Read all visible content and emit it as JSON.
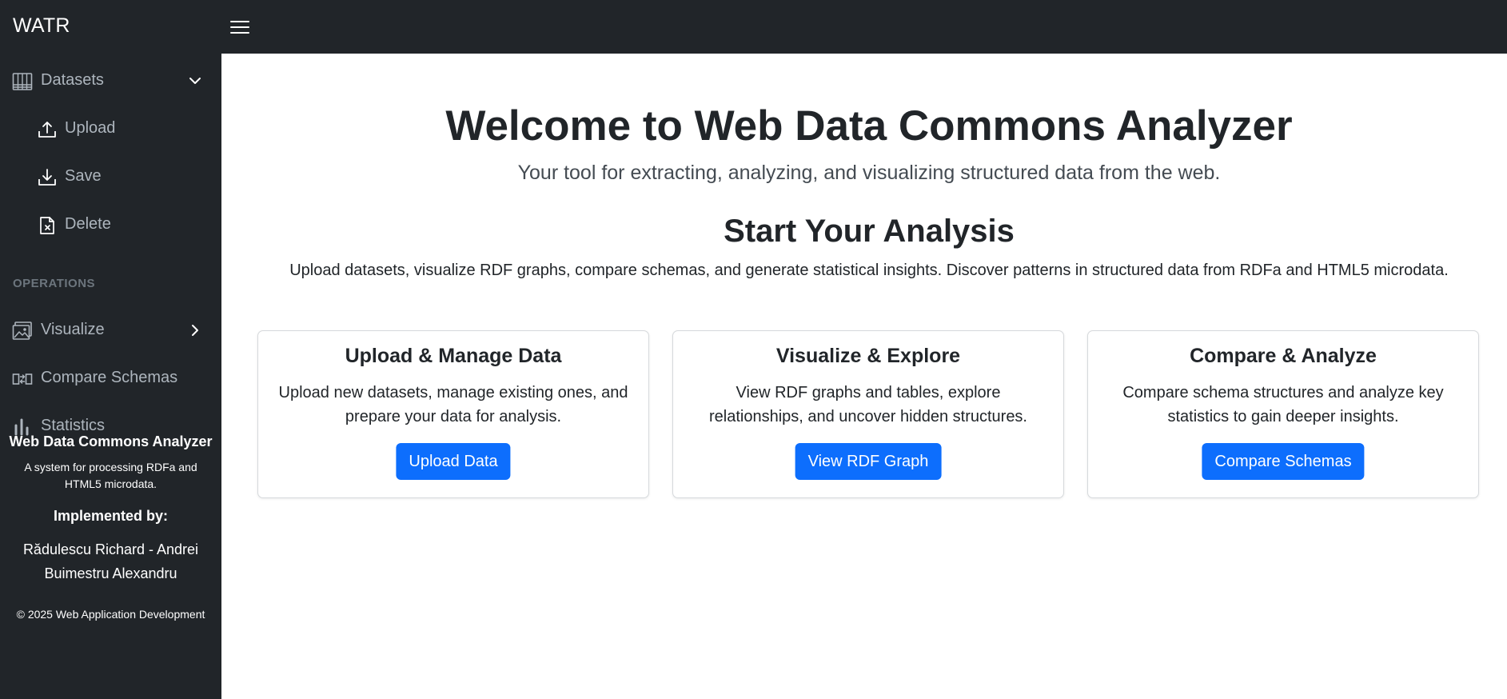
{
  "app": {
    "brand": "WATR"
  },
  "sidebar": {
    "datasets": {
      "label": "Datasets",
      "icon": "dataset-grid-icon",
      "expanded": true,
      "items": [
        {
          "label": "Upload",
          "icon": "upload-icon"
        },
        {
          "label": "Save",
          "icon": "download-icon"
        },
        {
          "label": "Delete",
          "icon": "file-x-icon"
        }
      ]
    },
    "section_label": "OPERATIONS",
    "operations": [
      {
        "label": "Visualize",
        "icon": "image-icon",
        "has_submenu": true
      },
      {
        "label": "Compare Schemas",
        "icon": "compare-icon"
      },
      {
        "label": "Statistics",
        "icon": "bar-chart-icon"
      }
    ],
    "footer": {
      "title": "Web Data Commons Analyzer",
      "description": "A system for processing RDFa and HTML5 microdata.",
      "implemented_by_label": "Implemented by:",
      "author_1": "Rădulescu Richard - Andrei",
      "author_2": "Buimestru Alexandru",
      "copyright": "© 2025 Web Application Development"
    }
  },
  "main": {
    "title": "Welcome to Web Data Commons Analyzer",
    "subtitle": "Your tool for extracting, analyzing, and visualizing structured data from the web.",
    "section_heading": "Start Your Analysis",
    "section_text": "Upload datasets, visualize RDF graphs, compare schemas, and generate statistical insights. Discover patterns in structured data from RDFa and HTML5 microdata.",
    "cards": [
      {
        "title": "Upload & Manage Data",
        "text": "Upload new datasets, manage existing ones, and prepare your data for analysis.",
        "button": "Upload Data"
      },
      {
        "title": "Visualize & Explore",
        "text": "View RDF graphs and tables, explore relationships, and uncover hidden structures.",
        "button": "View RDF Graph"
      },
      {
        "title": "Compare & Analyze",
        "text": "Compare schema structures and analyze key statistics to gain deeper insights.",
        "button": "Compare Schemas"
      }
    ]
  },
  "colors": {
    "dark_bg": "#212529",
    "primary": "#0d6efd",
    "muted": "#adb5bd"
  }
}
